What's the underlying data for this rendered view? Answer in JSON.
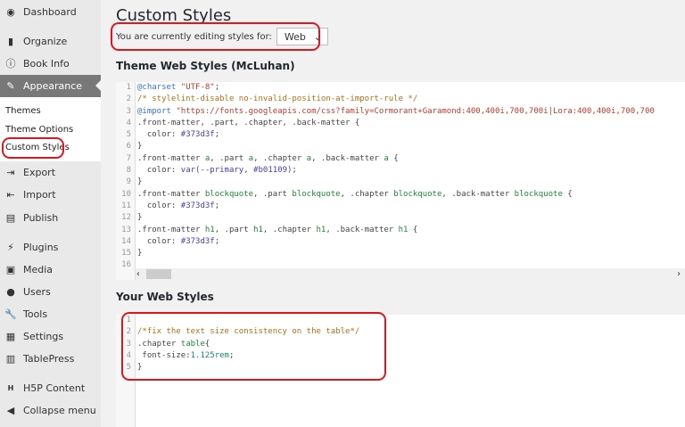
{
  "sidebar": {
    "items": [
      {
        "label": "Dashboard",
        "icon": "dashboard-icon"
      },
      {
        "label": "Organize",
        "icon": "book-icon"
      },
      {
        "label": "Book Info",
        "icon": "info-icon"
      },
      {
        "label": "Appearance",
        "icon": "paintbrush-icon"
      },
      {
        "label": "Export",
        "icon": "export-icon"
      },
      {
        "label": "Import",
        "icon": "import-icon"
      },
      {
        "label": "Publish",
        "icon": "publish-icon"
      },
      {
        "label": "Plugins",
        "icon": "plugins-icon"
      },
      {
        "label": "Media",
        "icon": "media-icon"
      },
      {
        "label": "Users",
        "icon": "users-icon"
      },
      {
        "label": "Tools",
        "icon": "wrench-icon"
      },
      {
        "label": "Settings",
        "icon": "settings-icon"
      },
      {
        "label": "TablePress",
        "icon": "table-icon"
      },
      {
        "label": "H5P Content",
        "icon": "h5p-icon"
      },
      {
        "label": "Collapse menu",
        "icon": "collapse-icon"
      }
    ],
    "submenu": [
      "Themes",
      "Theme Options",
      "Custom Styles"
    ]
  },
  "page": {
    "title": "Custom Styles",
    "editing_label": "You are currently editing styles for:",
    "selected": "Web"
  },
  "theme_section": {
    "title": "Theme Web Styles (McLuhan)",
    "lines": [
      [
        [
          "@charset",
          "k"
        ],
        [
          " \"UTF-8\"",
          "s"
        ],
        [
          ";",
          ""
        ]
      ],
      [
        [
          "/* stylelint-disable no-invalid-position-at-import-rule */",
          "cm"
        ]
      ],
      [
        [
          "@import",
          "k"
        ],
        [
          " \"https://fonts.googleapis.com/css?family=Cormorant+Garamond:400,400i,700,700i|Lora:400,400i,700,700",
          "s"
        ]
      ],
      [
        [
          ".front-matter, .part, .chapter, .back-matter {",
          ""
        ]
      ],
      [
        [
          "  color: ",
          ""
        ],
        [
          "#373d3f",
          "v"
        ],
        [
          ";",
          ""
        ]
      ],
      [
        [
          "}",
          ""
        ]
      ],
      [
        [
          ".front-matter ",
          ""
        ],
        [
          "a",
          "t"
        ],
        [
          ", .part ",
          ""
        ],
        [
          "a",
          "t"
        ],
        [
          ", .chapter ",
          ""
        ],
        [
          "a",
          "t"
        ],
        [
          ", .back-matter ",
          ""
        ],
        [
          "a",
          "t"
        ],
        [
          " {",
          ""
        ]
      ],
      [
        [
          "  color: ",
          ""
        ],
        [
          "var(--primary, #b01109)",
          "v"
        ],
        [
          ";",
          ""
        ]
      ],
      [
        [
          "}",
          ""
        ]
      ],
      [
        [
          ".front-matter ",
          ""
        ],
        [
          "blockquote",
          "t"
        ],
        [
          ", .part ",
          ""
        ],
        [
          "blockquote",
          "t"
        ],
        [
          ", .chapter ",
          ""
        ],
        [
          "blockquote",
          "t"
        ],
        [
          ", .back-matter ",
          ""
        ],
        [
          "blockquote",
          "t"
        ],
        [
          " {",
          ""
        ]
      ],
      [
        [
          "  color: ",
          ""
        ],
        [
          "#373d3f",
          "v"
        ],
        [
          ";",
          ""
        ]
      ],
      [
        [
          "}",
          ""
        ]
      ],
      [
        [
          ".front-matter ",
          ""
        ],
        [
          "h1",
          "t"
        ],
        [
          ", .part ",
          ""
        ],
        [
          "h1",
          "t"
        ],
        [
          ", .chapter ",
          ""
        ],
        [
          "h1",
          "t"
        ],
        [
          ", .back-matter ",
          ""
        ],
        [
          "h1",
          "t"
        ],
        [
          " {",
          ""
        ]
      ],
      [
        [
          "  color: ",
          ""
        ],
        [
          "#373d3f",
          "v"
        ],
        [
          ";",
          ""
        ]
      ],
      [
        [
          "}",
          ""
        ]
      ],
      [
        [
          "",
          ""
        ]
      ]
    ]
  },
  "your_section": {
    "title": "Your Web Styles",
    "lines": [
      [
        [
          "",
          ""
        ]
      ],
      [
        [
          "/*fix the text size consistency on the table*/",
          "cm"
        ]
      ],
      [
        [
          ".chapter ",
          ""
        ],
        [
          "table",
          "t"
        ],
        [
          "{",
          ""
        ]
      ],
      [
        [
          " font-size:",
          ""
        ],
        [
          "1.125rem",
          "num"
        ],
        [
          ";",
          ""
        ]
      ],
      [
        [
          "}",
          ""
        ]
      ]
    ]
  }
}
